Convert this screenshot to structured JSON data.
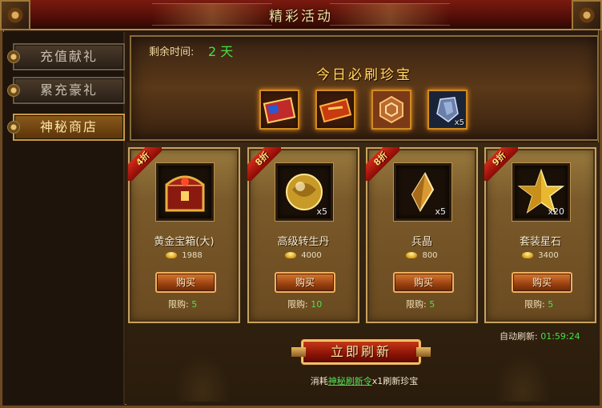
{
  "window": {
    "title": "精彩活动"
  },
  "sidebar": {
    "items": [
      {
        "label": "充值献礼",
        "active": false
      },
      {
        "label": "累充豪礼",
        "active": false
      },
      {
        "label": "神秘商店",
        "active": true
      }
    ]
  },
  "banner": {
    "remain_label": "剩余时间:",
    "remain_value": "2 天",
    "heading": "今日必刷珍宝",
    "treasures": [
      {
        "icon": "red-envelope-icon",
        "qty": ""
      },
      {
        "icon": "scroll-icon",
        "qty": ""
      },
      {
        "icon": "hexagon-token-icon",
        "qty": ""
      },
      {
        "icon": "crystal-shard-icon",
        "qty": "x5"
      }
    ]
  },
  "cards": [
    {
      "discount": "4折",
      "name": "黄金宝箱(大)",
      "price": "1988",
      "buy": "购买",
      "limit_label": "限购:",
      "limit_value": "5",
      "qty": "",
      "icon": "golden-chest-icon"
    },
    {
      "discount": "8折",
      "name": "高级转生丹",
      "price": "4000",
      "buy": "购买",
      "limit_label": "限购:",
      "limit_value": "10",
      "qty": "x5",
      "icon": "golden-orb-icon"
    },
    {
      "discount": "8折",
      "name": "兵晶",
      "price": "800",
      "buy": "购买",
      "limit_label": "限购:",
      "limit_value": "5",
      "qty": "x5",
      "icon": "crystal-icon"
    },
    {
      "discount": "9折",
      "name": "套装星石",
      "price": "3400",
      "buy": "购买",
      "limit_label": "限购:",
      "limit_value": "5",
      "qty": "x20",
      "icon": "boss-star-icon"
    }
  ],
  "auto_refresh": {
    "label": "自动刷新:",
    "time": "01:59:24"
  },
  "refresh_button": "立即刷新",
  "consume": {
    "prefix": "消耗",
    "link": "神秘刷新令",
    "suffix": "x1刷新珍宝"
  },
  "colors": {
    "accent_gold": "#ffdc60",
    "highlight_green": "#46e046",
    "title_red": "#7a1a10"
  }
}
